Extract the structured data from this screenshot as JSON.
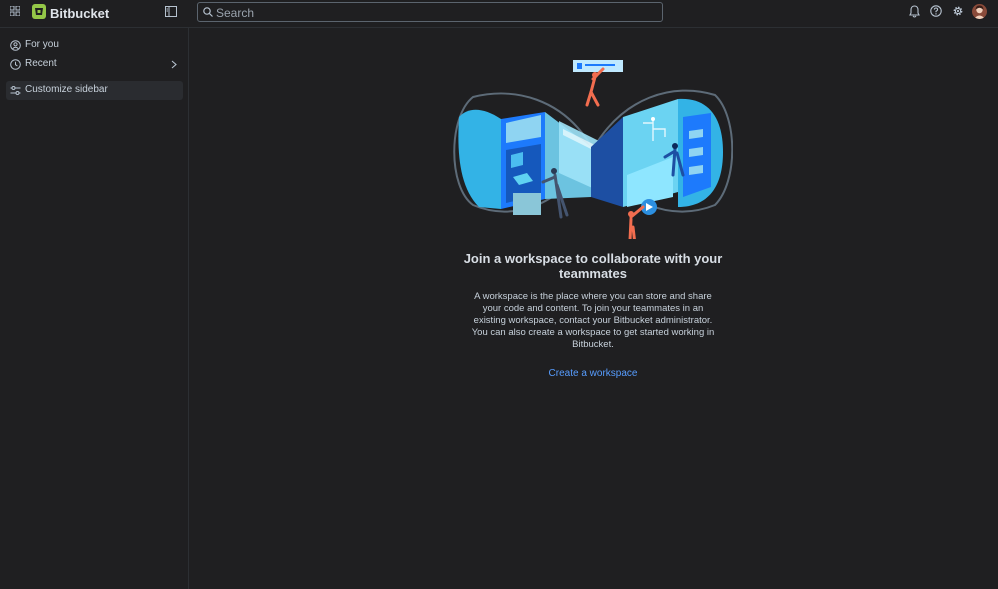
{
  "topbar": {
    "product_name": "Bitbucket",
    "search_placeholder": "Search",
    "icons": [
      "app-switcher-icon",
      "bitbucket-logo-icon",
      "sidebar-toggle-icon",
      "search-icon",
      "notifications-icon",
      "help-icon",
      "settings-icon"
    ]
  },
  "sidebar": {
    "items": [
      {
        "label": "For you",
        "icon": "person-circle-icon"
      },
      {
        "label": "Recent",
        "icon": "clock-icon"
      },
      {
        "label": "Customize sidebar",
        "icon": "sliders-icon"
      }
    ]
  },
  "main": {
    "heading": "Join a workspace to collaborate with your teammates",
    "body": "A workspace is the place where you can store and share your code and content. To join your teammates in an existing workspace, contact your Bitbucket administrator. You can also create a workspace to get started working in Bitbucket.",
    "cta": "Create a workspace"
  },
  "colors": {
    "background": "#1f1f21",
    "link": "#579dff",
    "logo": "#94c748"
  }
}
